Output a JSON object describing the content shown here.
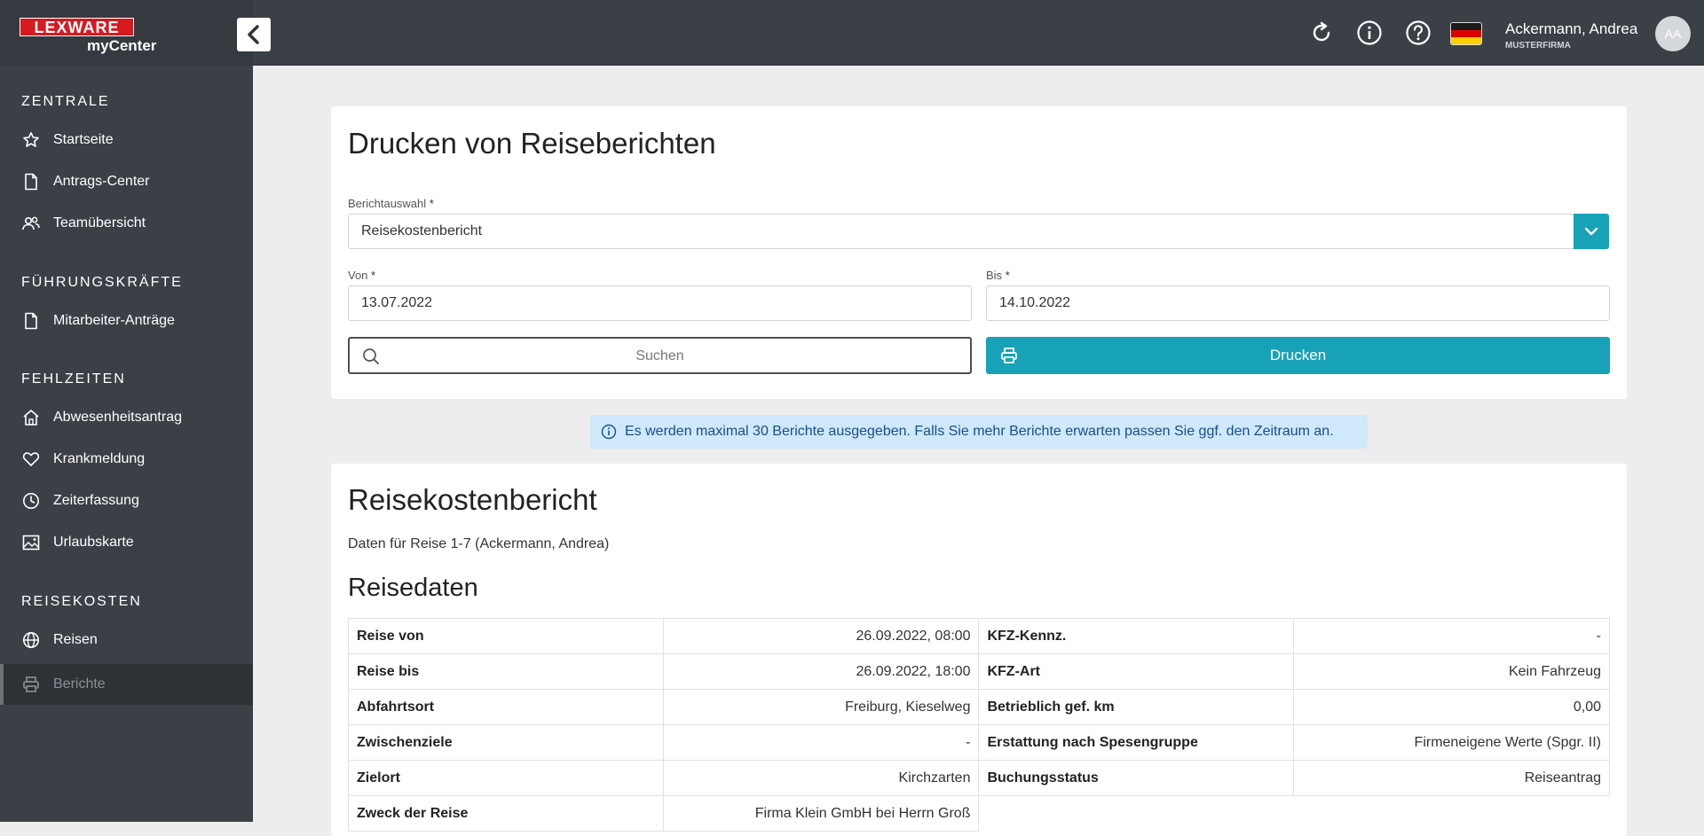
{
  "brand": {
    "logo": "LEXWARE",
    "product": "myCenter"
  },
  "header": {
    "icons": [
      "refresh-icon",
      "info-icon",
      "help-icon"
    ],
    "language": "de",
    "user_name": "Ackermann, Andrea",
    "company": "MUSTERFIRMA",
    "avatar_initials": "AA"
  },
  "sidebar": {
    "sections": [
      {
        "title": "ZENTRALE",
        "items": [
          {
            "label": "Startseite",
            "icon": "star-icon"
          },
          {
            "label": "Antrags-Center",
            "icon": "document-icon"
          },
          {
            "label": "Teamübersicht",
            "icon": "team-icon"
          }
        ]
      },
      {
        "title": "FÜHRUNGSKRÄFTE",
        "items": [
          {
            "label": "Mitarbeiter-Anträge",
            "icon": "document-icon"
          }
        ]
      },
      {
        "title": "FEHLZEITEN",
        "items": [
          {
            "label": "Abwesenheitsantrag",
            "icon": "home-icon"
          },
          {
            "label": "Krankmeldung",
            "icon": "heart-icon"
          },
          {
            "label": "Zeiterfassung",
            "icon": "clock-icon"
          },
          {
            "label": "Urlaubskarte",
            "icon": "image-icon"
          }
        ]
      },
      {
        "title": "REISEKOSTEN",
        "items": [
          {
            "label": "Reisen",
            "icon": "globe-icon"
          },
          {
            "label": "Berichte",
            "icon": "printer-icon",
            "active": true
          }
        ]
      }
    ]
  },
  "form": {
    "title": "Drucken von Reiseberichten",
    "report_label": "Berichtauswahl",
    "report_value": "Reisekostenbericht",
    "from_label": "Von",
    "from_value": "13.07.2022",
    "to_label": "Bis",
    "to_value": "14.10.2022",
    "required_mark": "*",
    "search_placeholder": "Suchen",
    "print_label": "Drucken"
  },
  "alert": {
    "text": "Es werden maximal 30 Berichte ausgegeben. Falls Sie mehr Berichte erwarten passen Sie ggf. den Zeitraum an."
  },
  "report": {
    "title": "Reisekostenbericht",
    "subtitle": "Daten für Reise 1-7 (Ackermann, Andrea)",
    "section_title": "Reisedaten",
    "rows": [
      {
        "k1": "Reise von",
        "v1": "26.09.2022, 08:00",
        "k2": "KFZ-Kennz.",
        "v2": "-"
      },
      {
        "k1": "Reise bis",
        "v1": "26.09.2022, 18:00",
        "k2": "KFZ-Art",
        "v2": "Kein Fahrzeug"
      },
      {
        "k1": "Abfahrtsort",
        "v1": "Freiburg, Kieselweg",
        "k2": "Betrieblich gef. km",
        "v2": "0,00"
      },
      {
        "k1": "Zwischenziele",
        "v1": "-",
        "k2": "Erstattung nach Spesengruppe",
        "v2": "Firmeneigene Werte (Spgr. II)"
      },
      {
        "k1": "Zielort",
        "v1": "Kirchzarten",
        "k2": "Buchungsstatus",
        "v2": "Reiseantrag"
      },
      {
        "k1": "Zweck der Reise",
        "v1": "Firma Klein GmbH bei Herrn Groß",
        "k2": "",
        "v2": ""
      }
    ]
  },
  "colors": {
    "accent": "#17a2b8",
    "sidebar": "#3a4046",
    "logo_red": "#d71920",
    "alert_bg": "#cfe8fa"
  }
}
